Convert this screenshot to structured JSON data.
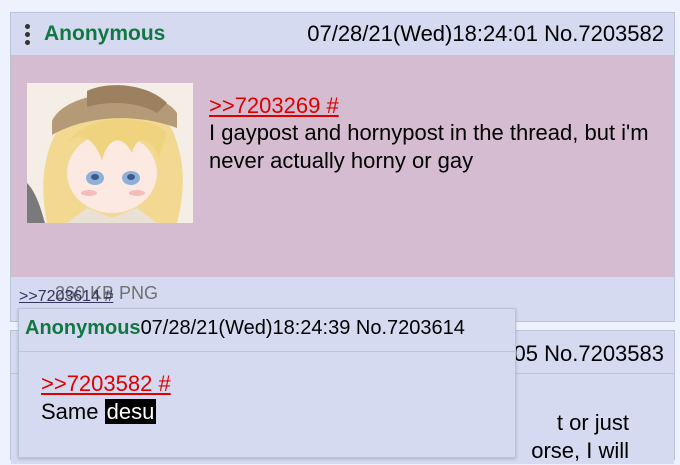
{
  "post1": {
    "name": "Anonymous",
    "datetime_no": "07/28/21(Wed)18:24:01 No.7203582",
    "file_info": "260 KB PNG",
    "quote_link": ">>7203269 #",
    "text": "I gaypost and hornypost in the thread, but i'm never actually horny or gay",
    "backlink": ">>7203614 #"
  },
  "post2": {
    "datetime_fragment": "05 No.7203583",
    "text_fragment_1": "t or just",
    "text_fragment_2": "orse, I will"
  },
  "popup": {
    "name": "Anonymous",
    "datetime_no": "07/28/21(Wed)18:24:39 No.7203614",
    "quote_link": ">>7203582 #",
    "text_plain": "Same ",
    "text_spoiler": "desu"
  },
  "colors": {
    "name_green": "#117743",
    "link_red": "#dd0000",
    "post_bg": "#d6daf0",
    "highlight_bg": "#d6bcd0"
  }
}
